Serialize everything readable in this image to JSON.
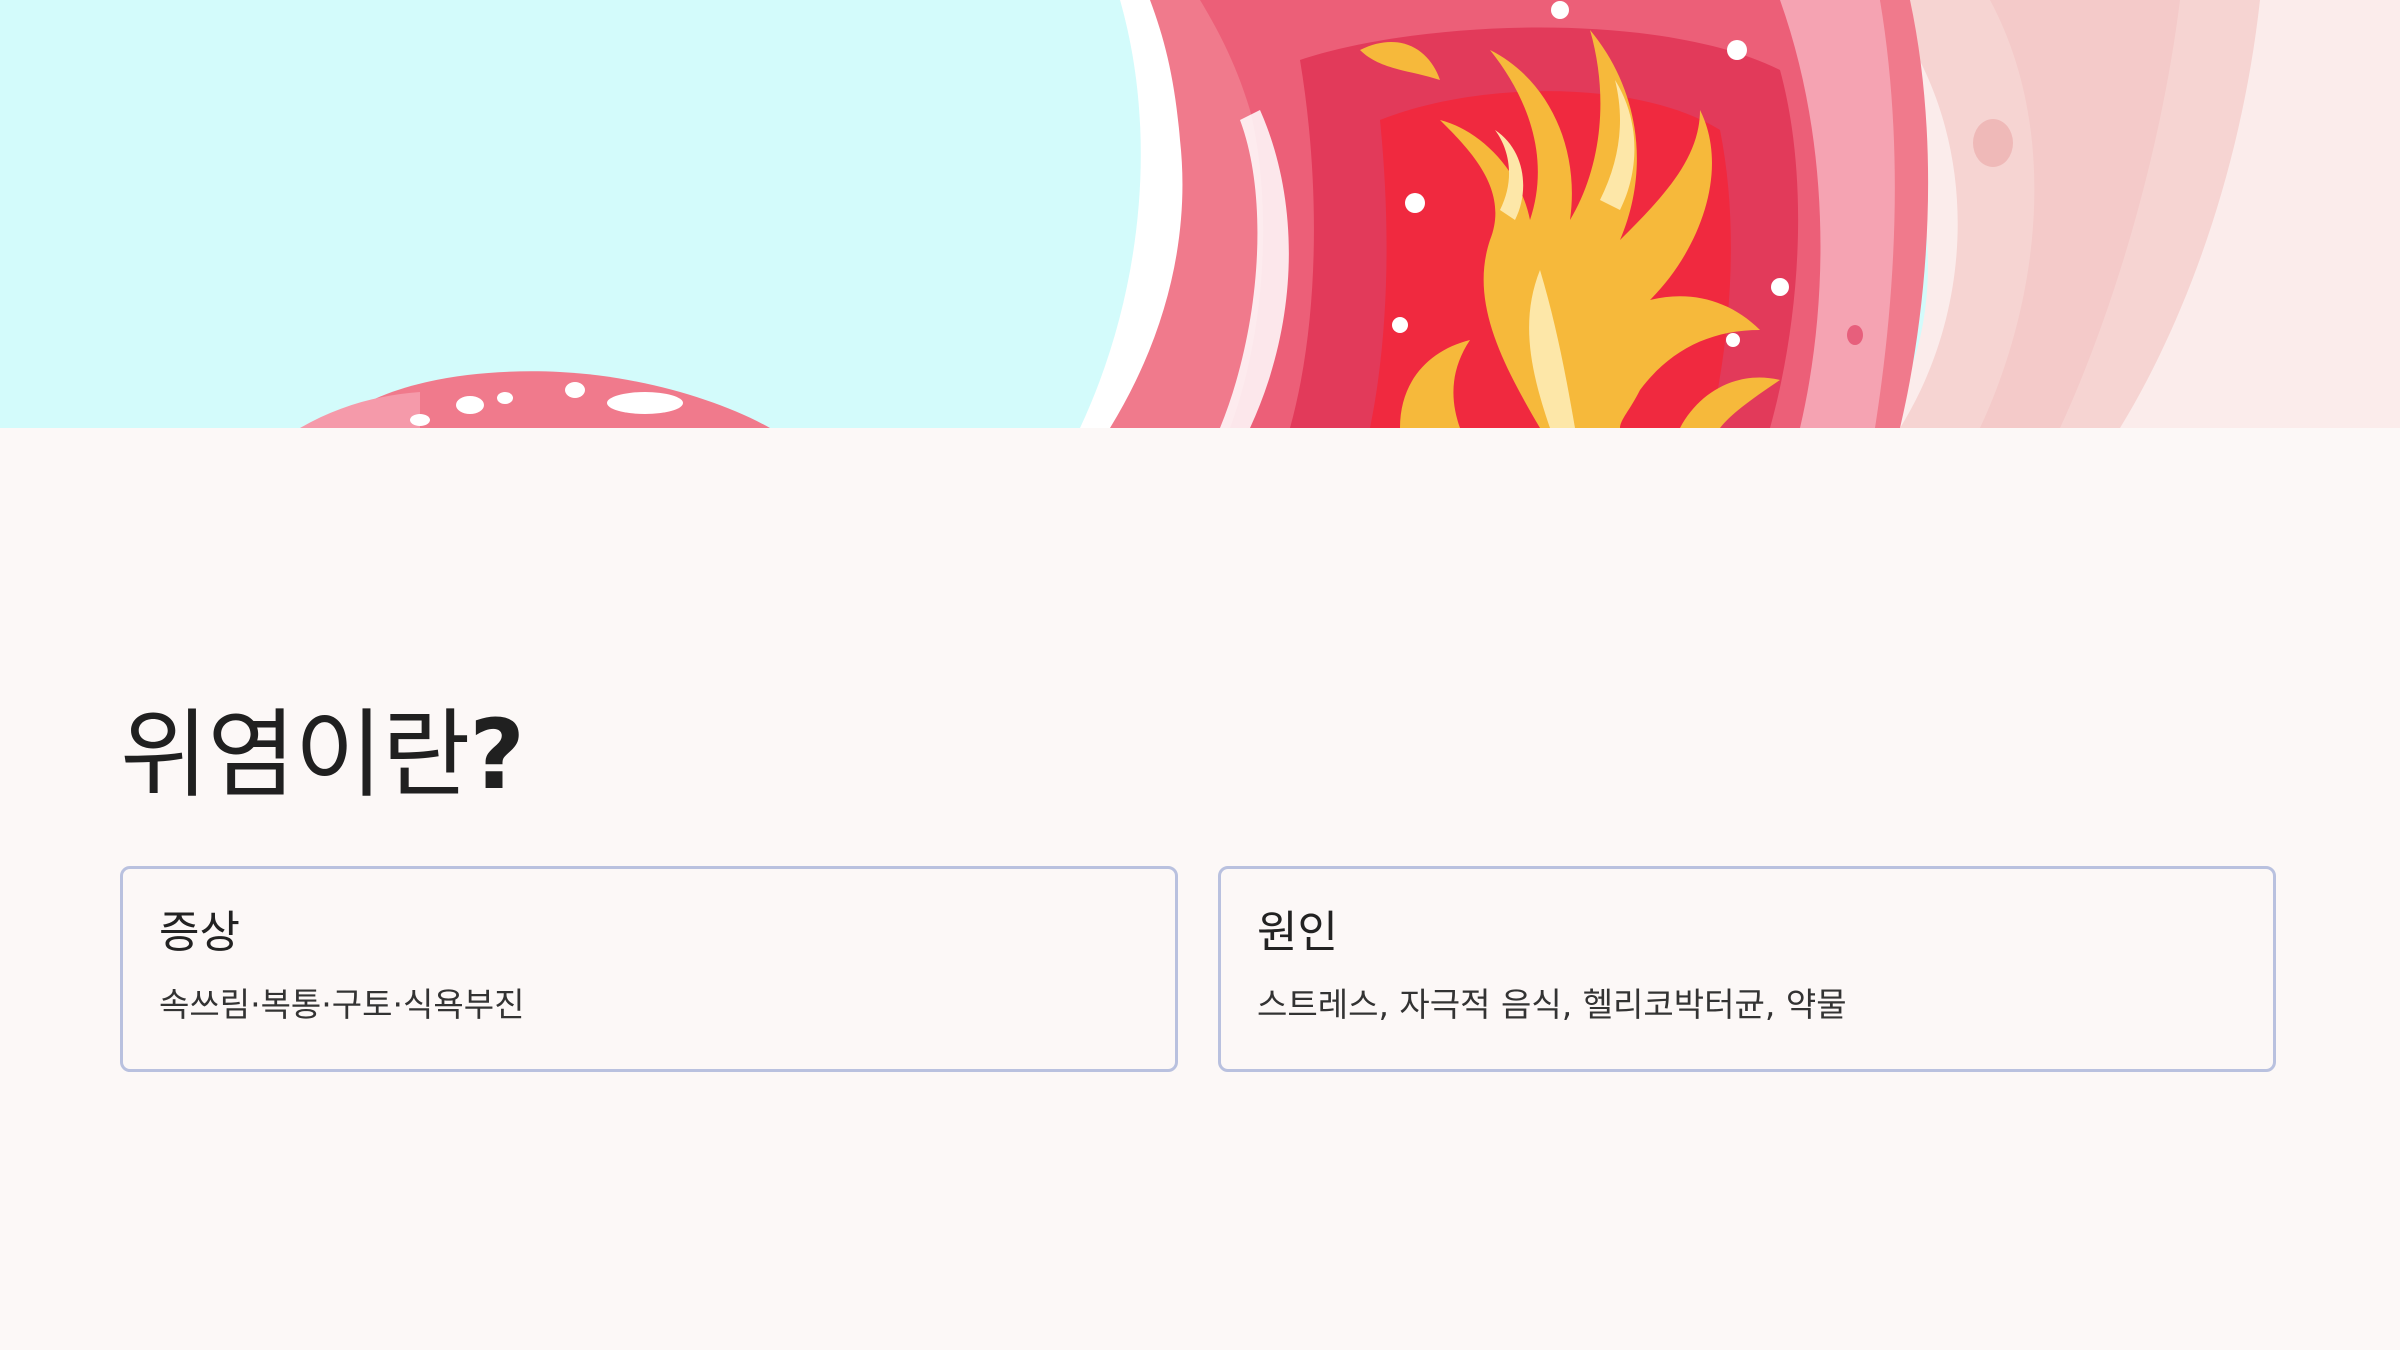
{
  "slide": {
    "title_main": "위염이란",
    "title_mark": "?",
    "cards": [
      {
        "heading": "증상",
        "body": "속쓰림·복통·구토·식욕부진"
      },
      {
        "heading": "원인",
        "body": "스트레스, 자극적 음식, 헬리코박터균, 약물"
      }
    ]
  },
  "hero_image": {
    "icon": "inflamed-stomach-illustration",
    "colors": {
      "background": "#d3fbfb",
      "tissue": "#f07a8c",
      "inner": "#e23a5a",
      "flame": "#f6b93b",
      "wall": "#f6d4d2"
    }
  },
  "colors": {
    "page_background": "#fcf8f7",
    "card_border": "#b9c1df",
    "text": "#202020"
  }
}
